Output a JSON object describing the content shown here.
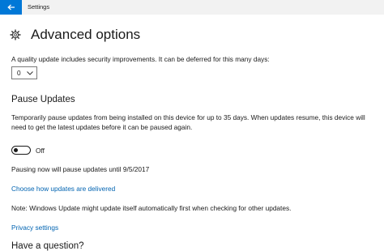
{
  "window": {
    "app_title": "Settings"
  },
  "header": {
    "title": "Advanced options",
    "icon": "gear-icon"
  },
  "quality_update": {
    "description": "A quality update includes security improvements. It can be deferred for this many days:",
    "selected_value": "0"
  },
  "pause_updates": {
    "heading": "Pause Updates",
    "description_line1": "Temporarily pause updates from being installed on this device for up to 35 days. When updates resume, this device will",
    "description_line2": "need to get the latest updates before it can be paused again.",
    "toggle_state": "Off",
    "pause_until": "Pausing now will pause updates until 9/5/2017"
  },
  "links": {
    "choose_delivery": "Choose how updates are delivered",
    "privacy": "Privacy settings"
  },
  "note": "Note: Windows Update might update itself automatically first when checking for other updates.",
  "next_section_heading": "Have a question?",
  "colors": {
    "accent": "#0078d7",
    "link": "#0063b1"
  }
}
